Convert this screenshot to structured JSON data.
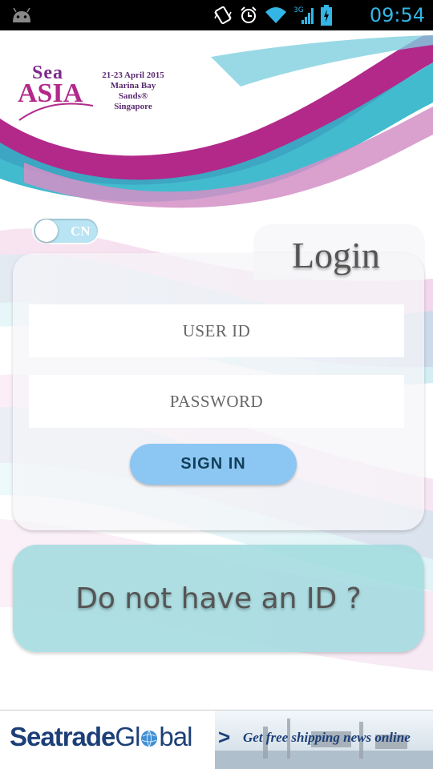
{
  "status_bar": {
    "time": "09:54",
    "network": "3G",
    "icons": [
      "android-icon",
      "vibrate-icon",
      "alarm-icon",
      "wifi-icon",
      "signal-icon",
      "battery-charging-icon"
    ]
  },
  "header": {
    "logo_sea": "Sea",
    "logo_asia": "ASIA",
    "event_dates": "21-23 April 2015",
    "event_venue": "Marina Bay Sands®",
    "event_city": "Singapore"
  },
  "language_toggle": {
    "label": "CN",
    "state": "off"
  },
  "login": {
    "title": "Login",
    "user_id_placeholder": "USER ID",
    "user_id_value": "",
    "password_placeholder": "PASSWORD",
    "password_value": "",
    "sign_in_label": "SIGN IN"
  },
  "register": {
    "label": "Do not have an ID ?"
  },
  "ad": {
    "brand_part1": "Seatrade",
    "brand_part2": "Gl",
    "brand_part3": "bal",
    "arrow": ">",
    "text": "Get free shipping news online"
  },
  "colors": {
    "accent_purple": "#b2298a",
    "accent_teal": "#2fb4c9",
    "sign_in_button": "#8cc6f2",
    "register_panel": "#a0dade",
    "ad_text": "#1c3f77",
    "clock": "#33b5e5"
  }
}
